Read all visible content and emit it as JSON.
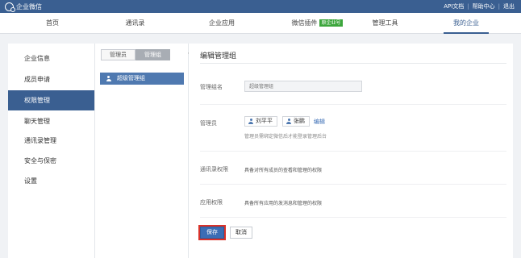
{
  "app": {
    "title": "企业微信"
  },
  "toplinks": [
    "API文档",
    "帮助中心",
    "退出"
  ],
  "nav": {
    "items": [
      {
        "label": "首页"
      },
      {
        "label": "通讯录"
      },
      {
        "label": "企业应用"
      },
      {
        "label": "微信插件",
        "badge": "原企业号"
      },
      {
        "label": "管理工具"
      },
      {
        "label": "我的企业"
      }
    ],
    "active": "我的企业"
  },
  "sidebar": {
    "items": [
      {
        "label": "企业信息"
      },
      {
        "label": "成员申请"
      },
      {
        "label": "权限管理"
      },
      {
        "label": "聊天管理"
      },
      {
        "label": "通讯录管理"
      },
      {
        "label": "安全与保密"
      },
      {
        "label": "设置"
      }
    ],
    "active": "权限管理"
  },
  "groups": {
    "tabs": [
      "管理员",
      "管理组"
    ],
    "active_tab": "管理组",
    "add_label": "+",
    "items": [
      {
        "label": "超级管理组"
      }
    ]
  },
  "main": {
    "title": "编辑管理组",
    "name_label": "管理组名",
    "name_placeholder": "超级管理组",
    "admins_label": "管理员",
    "admins": [
      "刘平平",
      "张鹏"
    ],
    "edit_label": "编辑",
    "admins_hint": "管理员需绑定微信后才能登录管理后台",
    "contacts_label": "通讯录权限",
    "contacts_text": "具备对所有成员的查看和管理的权限",
    "apps_label": "应用权限",
    "apps_text": "具备所有应用的发消息和管理的权限",
    "save_label": "保存",
    "cancel_label": "取消"
  },
  "colors": {
    "brand": "#3a5f91",
    "active_item": "#4f79b0",
    "primary_button": "#3a6db5",
    "badge": "#3ca63c",
    "highlight_outline": "#d9322a"
  }
}
